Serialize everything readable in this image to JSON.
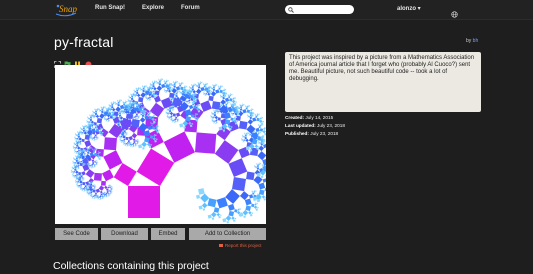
{
  "header": {
    "logo_text": "Snap!",
    "nav": [
      "Run Snap!",
      "Explore",
      "Forum"
    ],
    "search_placeholder": "",
    "username": "alonzo",
    "user_caret": "▾"
  },
  "project": {
    "title": "py-fractal",
    "by_label": "by",
    "author": "bh",
    "notes": "This project was inspired by a picture from a Mathematics Association of America journal article that I forget who (probably Al Cuoco?) sent me.  Beautiful picture, not such beautiful code -- took a lot of debugging.",
    "created_label": "Created:",
    "created": "July 14, 2015",
    "updated_label": "Last updated:",
    "updated": "July 23, 2018",
    "published_label": "Published:",
    "published": "July 23, 2018"
  },
  "actions": {
    "see_code": "See Code",
    "download": "Download",
    "embed": "Embed",
    "add_collection": "Add to Collection",
    "report": "Report this project"
  },
  "collections_heading": "Collections containing this project",
  "colors": {
    "accent_green": "#4caf50",
    "pause_yellow": "#f2c028",
    "stop_red": "#e84c4c",
    "tree_magenta": "#e21ae8",
    "tree_purple": "#8a3cf0",
    "tree_blue": "#3a68f8"
  },
  "icons": [
    "snap-logo-icon",
    "search-icon",
    "globe-icon",
    "fullscreen-icon",
    "green-flag-icon",
    "pause-icon",
    "stop-icon",
    "report-flag-icon"
  ]
}
